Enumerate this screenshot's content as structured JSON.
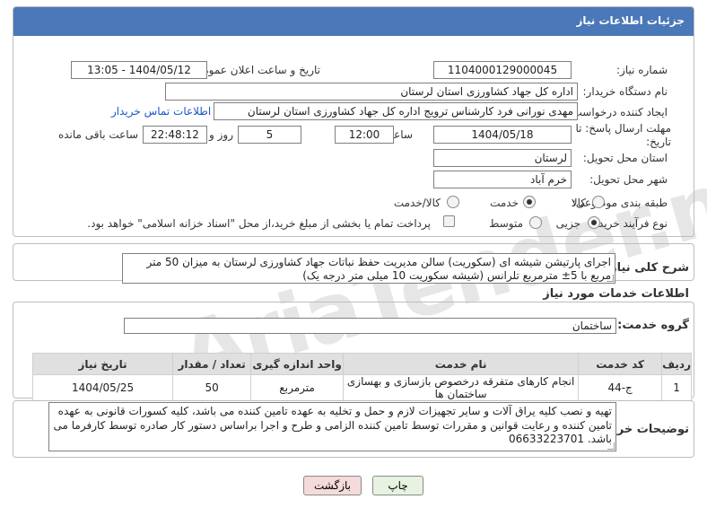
{
  "page": {
    "header_title": "جزئیات اطلاعات نیاز"
  },
  "need_no": {
    "label": "شماره نیاز:",
    "value": "1104000129000045"
  },
  "announce_dt": {
    "label": "تاریخ و ساعت اعلان عمومی:",
    "value": "1404/05/12 - 13:05"
  },
  "buyer_org": {
    "label": "نام دستگاه خریدار:",
    "value": "اداره کل جهاد کشاورزی استان لرستان"
  },
  "creator": {
    "label": "ایجاد کننده درخواست:",
    "value": "مهدی نورانی فرد کارشناس ترویج اداره کل جهاد کشاورزی استان لرستان",
    "contact_link": "اطلاعات تماس خریدار"
  },
  "deadline": {
    "label": "مهلت ارسال پاسخ: تا تاریخ:",
    "date": "1404/05/18",
    "time_label": "ساعت",
    "time": "12:00",
    "days": "5",
    "days_label": "روز و",
    "remaining": "22:48:12",
    "remaining_label": "ساعت باقی مانده"
  },
  "province": {
    "label": "استان محل تحویل:",
    "value": "لرستان"
  },
  "city": {
    "label": "شهر محل تحویل:",
    "value": "خرم آباد"
  },
  "category": {
    "label": "طبقه بندی موضوعی:",
    "options": [
      "کالا",
      "خدمت",
      "کالا/خدمت"
    ],
    "selected": "خدمت"
  },
  "purchase_type": {
    "label": "نوع فرآیند خرید :",
    "options": [
      "جزیی",
      "متوسط"
    ],
    "selected": "جزیی",
    "note": "پرداخت تمام یا بخشی از مبلغ خرید،از محل \"اسناد خزانه اسلامی\" خواهد بود."
  },
  "summary": {
    "label": "شرح کلی نیاز:",
    "text": "اجرای پارتیشن شیشه ای (سکوریت) سالن مدیریت حفظ نباتات جهاد کشاورزی لرستان به میزان 50 متر مربع با 5± مترمربع تلرانس (شیشه سکوریت 10 میلی متر درجه یک)"
  },
  "services_section": {
    "title": "اطلاعات خدمات مورد نیاز",
    "group_label": "گروه خدمت:",
    "group_value": "ساختمان"
  },
  "table": {
    "headers": [
      "ردیف",
      "کد خدمت",
      "نام خدمت",
      "واحد اندازه گیری",
      "تعداد / مقدار",
      "تاریخ نیاز"
    ],
    "rows": [
      [
        "1",
        "ج-44",
        "انجام کارهای متفرقه درخصوص بازسازی و بهسازی ساختمان ها",
        "مترمربع",
        "50",
        "1404/05/25"
      ]
    ]
  },
  "buyer_notes": {
    "label": "توضیحات خریدار:",
    "text": "تهیه و نصب کلیه یراق آلات و سایر تجهیزات لازم و حمل و تخلیه به عهده تامین کننده می باشد، کلیه کسورات قانونی به عهده تامین کننده و رعایت قوانین و مقررات توسط تامین کننده الزامی  و طرح و اجرا براساس دستور کار صادره توسط کارفرما می باشد. 06633223701"
  },
  "buttons": {
    "print": "چاپ",
    "back": "بازگشت"
  },
  "colors": {
    "header_bg": "#4a78b9",
    "back_btn_bg": "#f4dada",
    "print_btn_bg": "#e6f3e0"
  }
}
